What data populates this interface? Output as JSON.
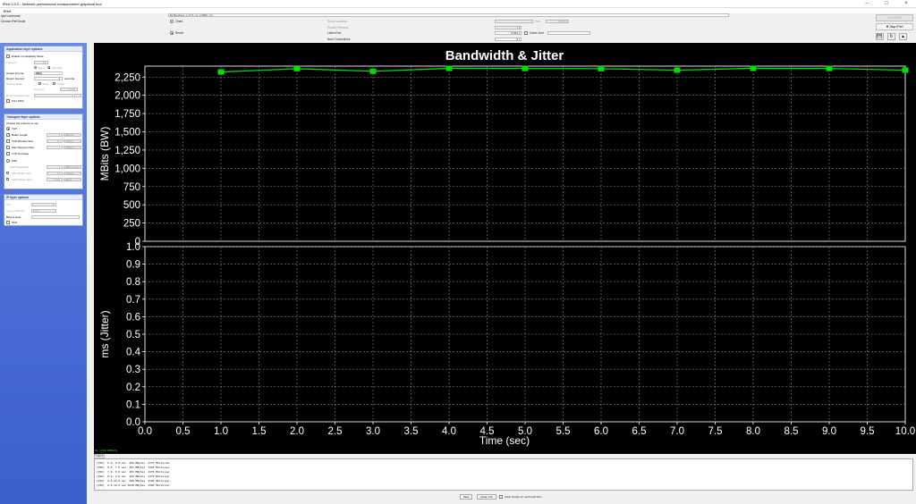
{
  "window": {
    "title": "iPerf 2.0.2 - Network performance measurement graphical tool",
    "menu": "JPerf"
  },
  "top": {
    "iperf_command_label": "Iperf command:",
    "iperf_command_value": "bin/iperf.exe -s -P 0 -i 1 -p 5001 -f m",
    "choose_mode_label": "Choose iPerf Mode:",
    "client_label": "Client",
    "server_label": "Server",
    "server_address_label": "Server address",
    "server_address_value": "",
    "port_label": "Port",
    "port_value": "5,001",
    "parallel_streams_label": "Parallel Streams",
    "parallel_streams_value": "1",
    "listen_port_label": "Listen Port",
    "listen_port_value": "5,001",
    "client_limit_label": "Client Limit",
    "client_limit_value": "",
    "num_connections_label": "Num Connections",
    "num_connections_value": "0"
  },
  "tools": {
    "run_label": "Run IPerf!",
    "stop_label": "Stop IPerf",
    "save_icon": "save-icon",
    "refresh_icon": "refresh-icon",
    "export_icon": "export-icon",
    "timestamp": "Fri, 3 Jul 2020 13:46:49"
  },
  "left": {
    "app_options": {
      "header": "Application layer options",
      "compat_label": "Enable Compatibility Mode",
      "transmit_label": "Transmit",
      "transmit_value": "10",
      "bytes_label": "Bytes",
      "seconds_label": "Seconds",
      "output_format_label": "Output Format",
      "output_format_value": "MBits",
      "report_interval_label": "Report Interval",
      "report_interval_value": "1",
      "report_interval_unit": "seconds",
      "testing_mode_label": "Testing Mode",
      "dual_label": "Dual",
      "trade_label": "Trade",
      "test_port_label": "test port",
      "test_port_value": "5,001",
      "representative_file_label": "Representative File",
      "print_mss_label": "Print MSS"
    },
    "transport_options": {
      "header": "Transport layer options",
      "choose_protocol_label": "Choose the protocol to use",
      "tcp_label": "TCP",
      "buffer_length_label": "Buffer Length",
      "buffer_length_value": "2",
      "buffer_length_unit": "MBytes",
      "window_size_label": "TCP Window Size",
      "window_size_value": "56",
      "window_size_unit": "KBytes",
      "mss_label": "Max Segment Size",
      "mss_value": "1",
      "mss_unit": "KBytes",
      "nodelay_label": "TCP No Delay",
      "udp_label": "UDP",
      "udp_bandwidth_label": "UDP Bandwidth",
      "udp_bandwidth_value": "1",
      "udp_bandwidth_unit": "MBytes/sec",
      "udp_buffer_label": "UDP Buffer Size",
      "udp_buffer_value": "41",
      "udp_buffer_unit": "KBytes",
      "udp_packet_label": "UDP Packet Size",
      "udp_packet_value": "1,500",
      "udp_packet_unit": "Bytes"
    },
    "ip_options": {
      "header": "IP layer options",
      "ttl_label": "TTL",
      "ttl_value": "1",
      "tos_label": "Type of Service",
      "tos_value": "None",
      "bind_label": "Bind to Host",
      "ipv6_label": "IPv6"
    }
  },
  "chart_data": [
    {
      "type": "line",
      "title": "Bandwidth & Jitter",
      "ylabel": "MBits (BW)",
      "xlabel": "",
      "xlim": [
        0,
        10
      ],
      "ylim": [
        0,
        2400
      ],
      "yticks": [
        0,
        250,
        500,
        750,
        1000,
        1250,
        1500,
        1750,
        2000,
        2250
      ],
      "ytick_labels": [
        "0",
        "250",
        "500",
        "750",
        "1,000",
        "1,250",
        "1,500",
        "1,750",
        "2,000",
        "2,250"
      ],
      "grid": true,
      "series": [
        {
          "color": "#00e000",
          "x": [
            1,
            2,
            3,
            4,
            5,
            6,
            7,
            8,
            9,
            10
          ],
          "y": [
            2320,
            2365,
            2330,
            2370,
            2368,
            2365,
            2345,
            2370,
            2368,
            2345
          ]
        }
      ]
    },
    {
      "type": "line",
      "ylabel": "ms (Jitter)",
      "xlabel": "Time (sec)",
      "xlim": [
        0,
        10
      ],
      "ylim": [
        0,
        1.0
      ],
      "xticks": [
        "0.0",
        "0.5",
        "1.0",
        "1.5",
        "2.0",
        "2.5",
        "3.0",
        "3.5",
        "4.0",
        "4.5",
        "5.0",
        "5.5",
        "6.0",
        "6.5",
        "7.0",
        "7.5",
        "8.0",
        "8.5",
        "9.0",
        "9.5",
        "10.0"
      ],
      "yticks": [
        "0.0",
        "0.1",
        "0.2",
        "0.3",
        "0.4",
        "0.5",
        "0.6",
        "0.7",
        "0.8",
        "0.9",
        "1.0"
      ],
      "grid": true,
      "series": []
    }
  ],
  "output": {
    "strip_text": "#1: [ 2320 MBits/s]",
    "tab_label": "Output",
    "lines": [
      "[256]  5.0- 6.0 sec  280 MBytes  2370 Mbits/sec",
      "[256]  6.0- 7.0 sec  281 MBytes  2366 Mbits/sec",
      "[256]  7.0- 8.0 sec  283 MBytes  2378 Mbits/sec",
      "[256]  8.0- 9.0 sec  282 MBytes  2376 Mbits/sec",
      "[256]  9.0-10.0 sec  280 MBytes  2348 Mbits/sec",
      "[256]  0.0-10.0 sec 2818 MBytes  2366 Mbits/sec"
    ],
    "save_label": "Save",
    "clear_label": "Clear now",
    "clear_each_label": "Clear Output on each Iperf Run"
  },
  "colors": {
    "accent_blue": "#4e70d8",
    "line_green": "#00e000"
  }
}
